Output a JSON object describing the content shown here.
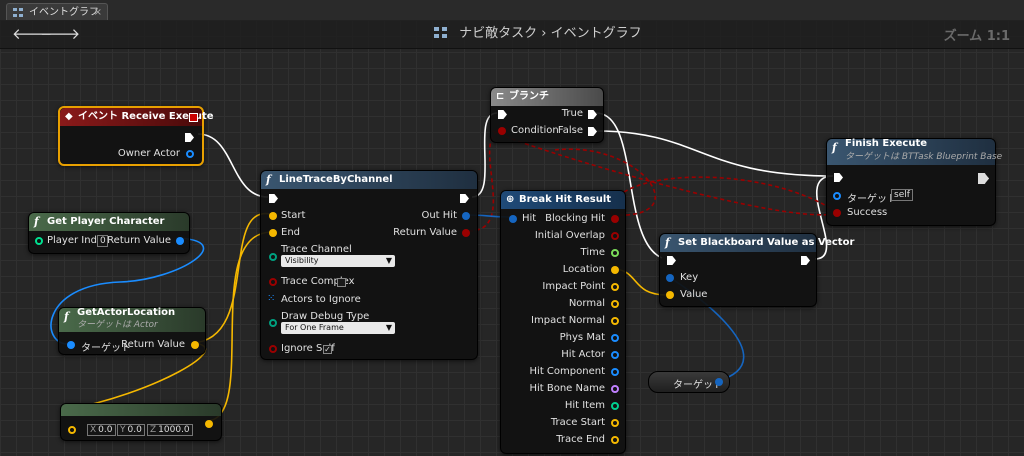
{
  "tab": {
    "label": "イベントグラフ",
    "close": "×"
  },
  "toolbar": {
    "back": "🡐",
    "forward": "🡒",
    "breadcrumb": "ナビ敵タスク › イベントグラフ",
    "zoom": "ズーム 1:1"
  },
  "nodes": {
    "receive_execute": {
      "title": "イベント Receive Execute",
      "owner_actor": "Owner Actor"
    },
    "get_player_character": {
      "title": "Get Player Character",
      "player_index": "Player Index",
      "player_index_value": "0",
      "return_value": "Return Value"
    },
    "get_actor_location": {
      "title": "GetActorLocation",
      "subtitle": "ターゲットは Actor",
      "target": "ターゲット",
      "return_value": "Return Value"
    },
    "make_vector": {
      "x": "0.0",
      "y": "0.0",
      "z": "1000.0",
      "x_label": "X",
      "y_label": "Y",
      "z_label": "Z"
    },
    "line_trace": {
      "title": "LineTraceByChannel",
      "start": "Start",
      "end": "End",
      "trace_channel": "Trace Channel",
      "trace_channel_value": "Visibility",
      "out_hit": "Out Hit",
      "return_value": "Return Value",
      "trace_complex": "Trace Complex",
      "actors_to_ignore": "Actors to Ignore",
      "draw_debug_type": "Draw Debug Type",
      "draw_debug_value": "For One Frame",
      "ignore_self": "Ignore Self",
      "ignore_self_check": "✓"
    },
    "branch": {
      "title": "ブランチ",
      "condition": "Condition",
      "true": "True",
      "false": "False"
    },
    "break_hit": {
      "title": "Break Hit Result",
      "hit": "Hit",
      "outputs": [
        "Blocking Hit",
        "Initial Overlap",
        "Time",
        "Location",
        "Impact Point",
        "Normal",
        "Impact Normal",
        "Phys Mat",
        "Hit Actor",
        "Hit Component",
        "Hit Bone Name",
        "Hit Item",
        "Trace Start",
        "Trace End"
      ]
    },
    "set_blackboard": {
      "title": "Set Blackboard Value as Vector",
      "key": "Key",
      "value": "Value"
    },
    "finish_execute": {
      "title": "Finish Execute",
      "subtitle": "ターゲットは BTTask Blueprint Base",
      "target": "ターゲット",
      "target_value": "self",
      "success": "Success"
    },
    "target_var": {
      "label": "ターゲット"
    }
  },
  "colors": {
    "exec": "#ffffff",
    "bool": "#9a0000",
    "vector": "#f5b800",
    "object": "#1a8cff",
    "struct": "#1565c0",
    "function_header": "#3a5670",
    "event_header": "#7a0f0f",
    "pure_header": "#3a5a3a"
  }
}
